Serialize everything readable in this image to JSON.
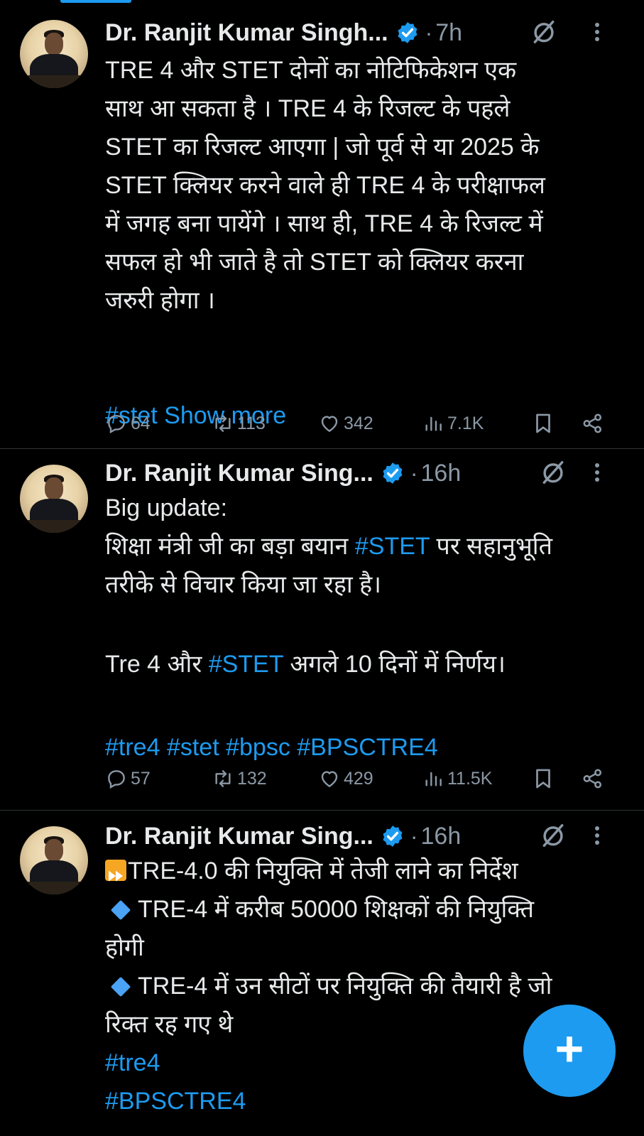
{
  "tweets": [
    {
      "author": "Dr. Ranjit Kumar Singh...",
      "time": "7h",
      "lines": [
        "TRE 4 और STET दोनों का नोटिफिकेशन  एक",
        "साथ आ सकता है । TRE 4 के रिजल्ट के पहले",
        "STET का रिजल्ट आएगा | जो पूर्व से या 2025 के",
        "STET क्लियर करने वाले ही TRE 4 के परीक्षाफल",
        "में जगह बना पायेंगे । साथ ही, TRE 4 के रिजल्ट में",
        "सफल हो भी जाते है तो STET को क्लियर करना",
        "जरुरी होगा ।"
      ],
      "hashtag": "#stet",
      "show_more": "Show more",
      "replies": "64",
      "reposts": "113",
      "likes": "342",
      "views": "7.1K"
    },
    {
      "author": "Dr. Ranjit Kumar Sing...",
      "time": "16h",
      "line1": "Big update:",
      "line2_pre": "शिक्षा मंत्री जी का बड़ा बयान ",
      "line2_tag": "#STET",
      "line2_post": " पर सहानुभूति",
      "line3": "तरीके से विचार किया जा रहा है।",
      "line4_pre": "Tre 4 और ",
      "line4_tag": "#STET",
      "line4_post": " अगले 10 दिनों में निर्णय।",
      "hashtags": "#tre4 #stet #bpsc #BPSCTRE4",
      "replies": "57",
      "reposts": "132",
      "likes": "429",
      "views": "11.5K"
    },
    {
      "author": "Dr. Ranjit Kumar Sing...",
      "time": "16h",
      "line1": "TRE-4.0 की नियुक्ति में तेजी लाने का निर्देश",
      "line2": "TRE-4  में करीब 50000 शिक्षकों की नियुक्ति",
      "line3": "होगी",
      "line4": "TRE-4 में उन सीटों पर नियुक्ति की तैयारी है जो",
      "line5": "रिक्त रह गए थे",
      "tag1": "#tre4",
      "tag2": "#BPSCTRE4"
    }
  ],
  "dot": "·",
  "fab_label": "+",
  "colors": {
    "background": "#000000",
    "accent": "#1d9bf0",
    "muted": "#8b98a5",
    "divider": "#2f3336"
  },
  "icons": [
    "verified-badge-icon",
    "grok-icon",
    "more-icon",
    "reply-icon",
    "repost-icon",
    "like-icon",
    "views-icon",
    "bookmark-icon",
    "share-icon",
    "plus-icon"
  ]
}
